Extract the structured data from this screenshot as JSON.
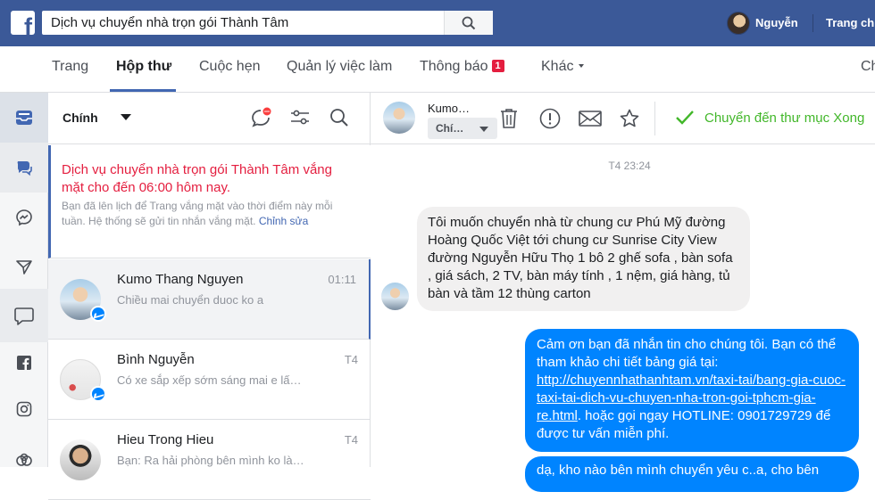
{
  "topbar": {
    "search_value": "Dịch vụ chuyển nhà trọn gói Thành Tâm",
    "user_name": "Nguyễn",
    "home_link": "Trang ch"
  },
  "tabs": [
    {
      "label": "Trang"
    },
    {
      "label": "Hộp thư"
    },
    {
      "label": "Cuộc hẹn"
    },
    {
      "label": "Quản lý việc làm"
    },
    {
      "label": "Thông báo",
      "badge": "1"
    },
    {
      "label": "Khác"
    },
    {
      "label": "Ch"
    }
  ],
  "list": {
    "title": "Chính",
    "away": {
      "title": "Dịch vụ chuyển nhà trọn gói Thành Tâm vắng mặt cho đến 06:00 hôm nay.",
      "text": "Bạn đã lên lịch để Trang vắng mặt vào thời điểm này mỗi tuần. Hệ thống sẽ gửi tin nhắn vắng mặt.",
      "link": "Chỉnh sửa"
    },
    "conversations": [
      {
        "name": "Kumo Thang Nguyen",
        "snippet": "Chiều mai chuyển duoc ko a",
        "time": "01:11"
      },
      {
        "name": "Bình Nguyễn",
        "snippet": "Có xe sắp xếp sớm sáng mai e lấ…",
        "time": "T4"
      },
      {
        "name": "Hieu Trong Hieu",
        "snippet": "Bạn: Ra hải phòng bên mình ko là…",
        "time": "T4"
      }
    ]
  },
  "thread": {
    "name": "Kumo…",
    "select_value": "Chí…",
    "done_label": "Chuyển đến thư mục Xong",
    "timestamp": "T4 23:24",
    "incoming": "Tôi muốn chuyển nhà từ chung cư Phú Mỹ đường Hoàng Quốc Việt tới chung cư Sunrise City View đường Nguyễn Hữu Thọ 1 bô 2 ghế sofa , bàn sofa , giá sách, 2 TV, bàn máy tính , 1 nệm, giá hàng, tủ bàn và tầm 12 thùng carton",
    "outgoing_before": "Cảm ơn bạn đã nhắn tin cho chúng tôi. Bạn có thể tham khảo chi tiết bảng giá tại:",
    "outgoing_link": "http://chuyennhathanhtam.vn/taxi-tai/bang-gia-cuoc-taxi-tai-dich-vu-chuyen-nha-tron-goi-tphcm-gia-re.html",
    "outgoing_after": ". hoặc gọi ngay HOTLINE: 0901729729 để được tư vấn miễn phí.",
    "outgoing2": "dạ, kho nào bên mình chuyển yêu c..a, cho bên"
  },
  "colors": {
    "topbar": "#3b5998",
    "accent": "#4267b2",
    "messenger": "#0084ff",
    "away_red": "#e41e3f",
    "done_green": "#42b72a"
  },
  "icons": [
    "search-icon",
    "inbox-icon",
    "chat-icon",
    "messenger-icon",
    "send-icon",
    "comment-icon",
    "facebook-icon",
    "instagram-icon",
    "pretzel-icon",
    "new-message-icon",
    "filter-icon",
    "trash-icon",
    "alert-icon",
    "mail-icon",
    "star-icon",
    "check-icon"
  ]
}
